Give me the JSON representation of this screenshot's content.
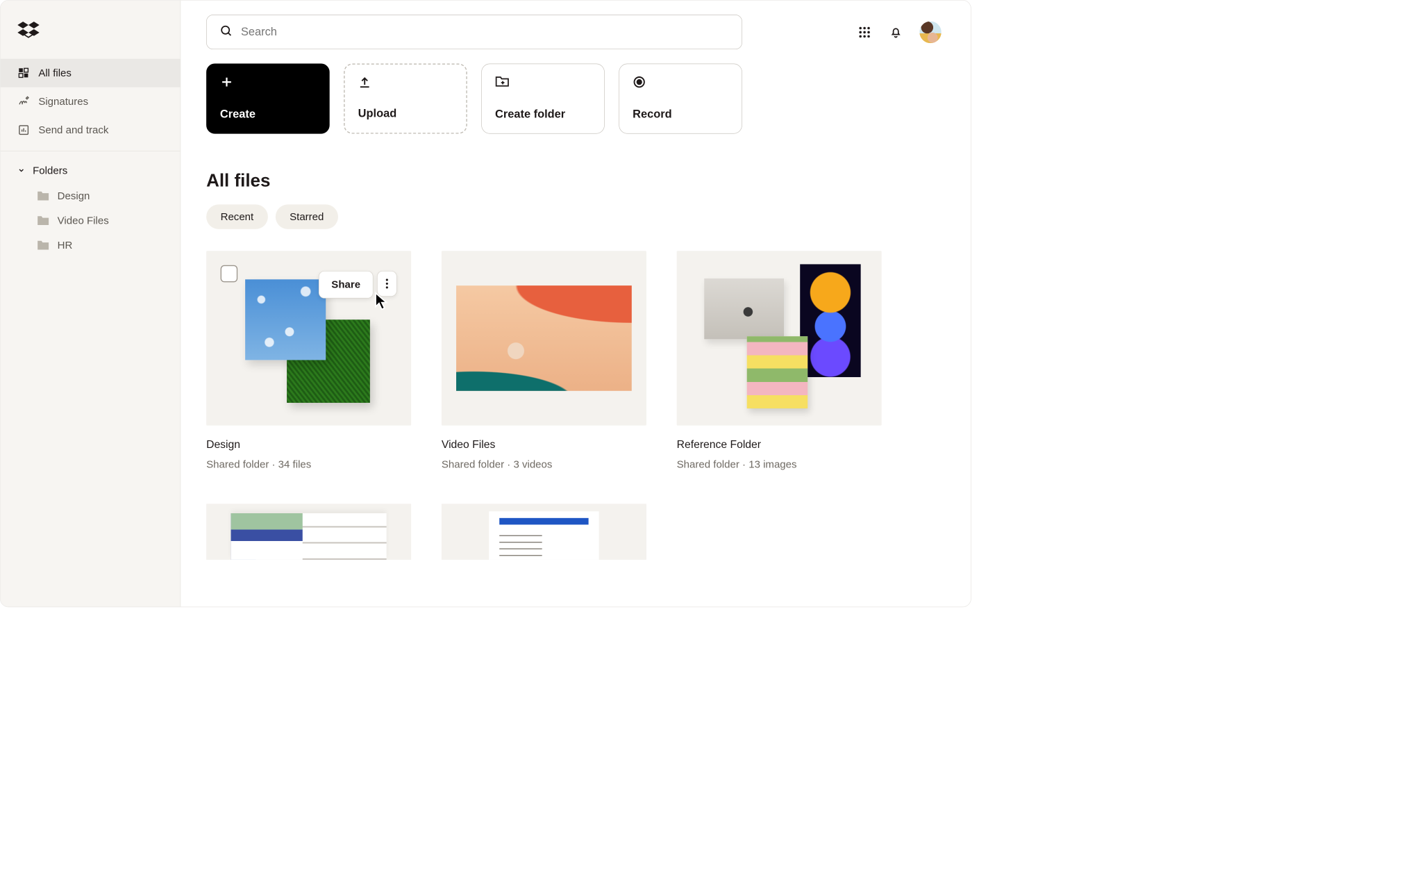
{
  "search": {
    "placeholder": "Search"
  },
  "sidebar": {
    "items": [
      {
        "label": "All files"
      },
      {
        "label": "Signatures"
      },
      {
        "label": "Send and track"
      }
    ],
    "folders_header": "Folders",
    "folders": [
      {
        "label": "Design"
      },
      {
        "label": "Video Files"
      },
      {
        "label": "HR"
      }
    ]
  },
  "actions": {
    "create": "Create",
    "upload": "Upload",
    "create_folder": "Create folder",
    "record": "Record"
  },
  "page_title": "All files",
  "filters": {
    "recent": "Recent",
    "starred": "Starred"
  },
  "hover": {
    "share": "Share"
  },
  "cards": [
    {
      "title": "Design",
      "sub": "Shared folder · 34 files"
    },
    {
      "title": "Video Files",
      "sub": "Shared folder · 3 videos"
    },
    {
      "title": "Reference Folder",
      "sub": "Shared folder · 13 images"
    }
  ]
}
